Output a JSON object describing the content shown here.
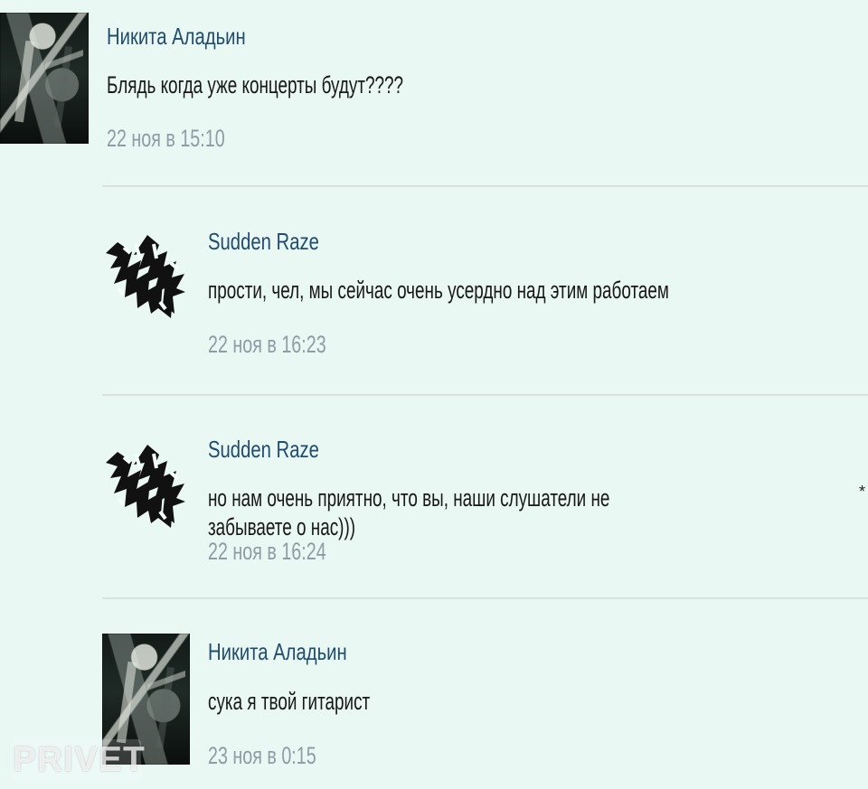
{
  "comments": [
    {
      "author": "Никита Аладьин",
      "message": "Блядь когда уже концерты будут????",
      "date": "22 ноя в 15:10"
    },
    {
      "author": "Sudden Raze",
      "message": "прости, чел, мы сейчас очень усердно над этим работаем",
      "date": "22 ноя в 16:23"
    },
    {
      "author": "Sudden Raze",
      "message": "но нам очень приятно, что вы, наши слушатели не забываете о нас)))",
      "date": "22 ноя в 16:24"
    },
    {
      "author": "Никита Аладьин",
      "message": "сука я твой гитарист",
      "date": "23 ноя в 0:15"
    }
  ],
  "extra": {
    "trailing_mark": "*"
  },
  "watermark": {
    "text": "PRIVET"
  }
}
